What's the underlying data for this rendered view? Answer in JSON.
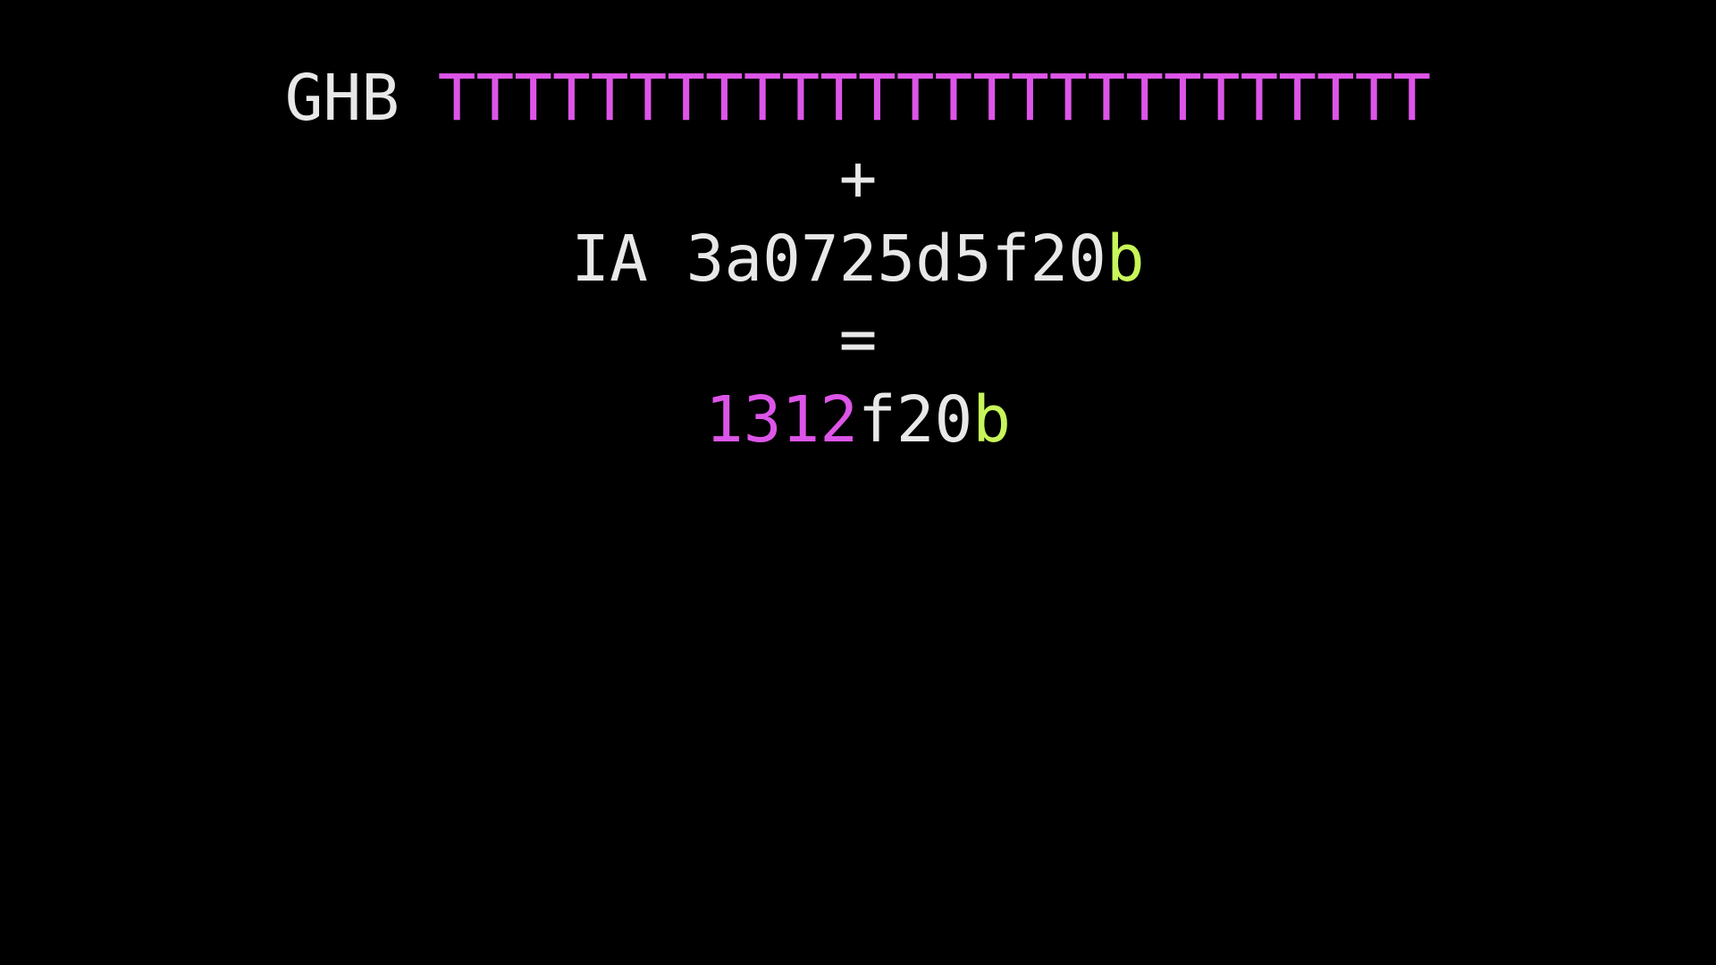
{
  "colors": {
    "background": "#000000",
    "text": "#e8e8e8",
    "magenta": "#dd55e8",
    "lime": "#c8f55a"
  },
  "row1": {
    "prefix": "GHB",
    "sep": " ",
    "highlight": "TTTTTTTTTTTTTTTTTTTTTTTTTT"
  },
  "op1": "+",
  "row2": {
    "prefix": "IA",
    "sep": " ",
    "hash": "3a0725d5f20",
    "tail": "b"
  },
  "op2": "=",
  "row3": {
    "head": "1312",
    "mid": "f20",
    "tail": "b"
  }
}
